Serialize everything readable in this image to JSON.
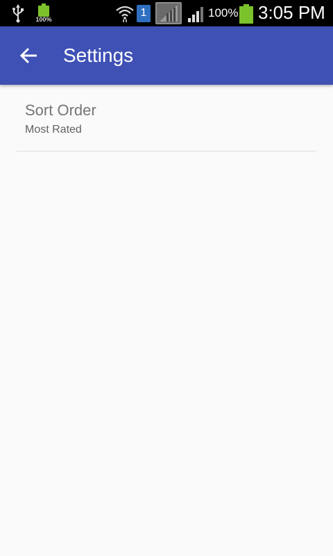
{
  "status_bar": {
    "small_battery_text": "100%",
    "sim_slot": "1",
    "battery_percent": "100%",
    "time": "3:05 PM",
    "icons": [
      "usb-icon",
      "battery-icon",
      "wifi-icon",
      "sim-icon",
      "no-signal-icon",
      "signal-icon",
      "battery-icon"
    ]
  },
  "app_bar": {
    "title": "Settings",
    "back_icon": "arrow-back-icon",
    "color": "#3f51b5"
  },
  "preferences": [
    {
      "title": "Sort Order",
      "summary": "Most Rated"
    }
  ]
}
